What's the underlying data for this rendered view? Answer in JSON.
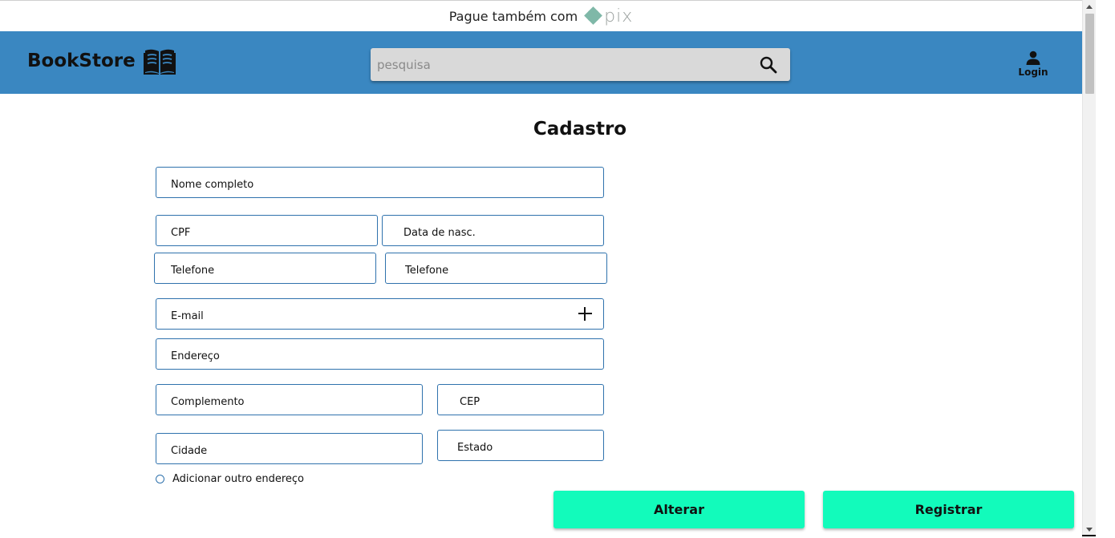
{
  "topbar": {
    "text": "Pague também com",
    "pix_logo_text": "pix"
  },
  "brand": {
    "name": "BookStore",
    "icon": "open-book-icon"
  },
  "search": {
    "placeholder": "pesquisa",
    "icon": "search-icon"
  },
  "account": {
    "label": "Login",
    "icon": "user-icon"
  },
  "page": {
    "title": "Cadastro"
  },
  "form": {
    "nome": "Nome completo",
    "cpf": "CPF",
    "data_nasc": "Data de nasc.",
    "telefone1": "Telefone",
    "telefone2": "Telefone",
    "email": "E-mail",
    "endereco": "Endereço",
    "complemento": "Complemento",
    "cep": "CEP",
    "cidade": "Cidade",
    "estado": "Estado",
    "add_endereco": "Adicionar outro endereço"
  },
  "actions": {
    "alterar": "Alterar",
    "registrar": "Registrar"
  },
  "colors": {
    "navbar": "#3a87c1",
    "button": "#12fbbb",
    "field_border": "#2f72ad"
  }
}
